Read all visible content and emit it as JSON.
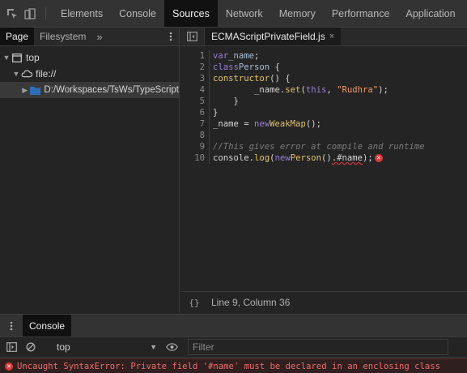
{
  "toolbar": {
    "tabs": [
      {
        "label": "Elements",
        "active": false
      },
      {
        "label": "Console",
        "active": false
      },
      {
        "label": "Sources",
        "active": true
      },
      {
        "label": "Network",
        "active": false
      },
      {
        "label": "Memory",
        "active": false
      },
      {
        "label": "Performance",
        "active": false
      },
      {
        "label": "Application",
        "active": false
      }
    ],
    "icons": [
      "inspect-icon",
      "device-toggle-icon"
    ]
  },
  "navigator": {
    "tabs": [
      {
        "label": "Page",
        "active": true
      },
      {
        "label": "Filesystem",
        "active": false
      }
    ],
    "more": "»",
    "tree": [
      {
        "label": "top",
        "icon": "frame-icon",
        "expanded": true
      },
      {
        "label": "file://",
        "icon": "cloud-icon",
        "expanded": true
      },
      {
        "label": "D:/Workspaces/TsWs/TypeScript",
        "icon": "folder-icon",
        "expanded": false
      }
    ]
  },
  "editor": {
    "file_tab": "ECMAScriptPrivateField.js",
    "close": "×",
    "lines": [
      {
        "n": "1",
        "text": "var _name;"
      },
      {
        "n": "2",
        "text": "class Person {"
      },
      {
        "n": "3",
        "text": "    constructor() {"
      },
      {
        "n": "4",
        "text": "        _name.set(this, \"Rudhra\");"
      },
      {
        "n": "5",
        "text": "    }"
      },
      {
        "n": "6",
        "text": "}"
      },
      {
        "n": "7",
        "text": "_name = new WeakMap();"
      },
      {
        "n": "8",
        "text": ""
      },
      {
        "n": "9",
        "text": "//This gives error at compile and runtime"
      },
      {
        "n": "10",
        "text": "console.log(new Person().#name);"
      }
    ],
    "status": {
      "braces": "{}",
      "position": "Line 9, Column 36"
    }
  },
  "drawer": {
    "tab": "Console",
    "context": "top",
    "filter_placeholder": "Filter",
    "error": "Uncaught SyntaxError: Private field '#name' must be declared in an enclosing class"
  },
  "colors": {
    "background": "#242424",
    "toolbar": "#333333",
    "active_tab": "#111111",
    "keyword": "#9a7fd5",
    "string": "#f29766",
    "error": "#ef6b6b"
  }
}
